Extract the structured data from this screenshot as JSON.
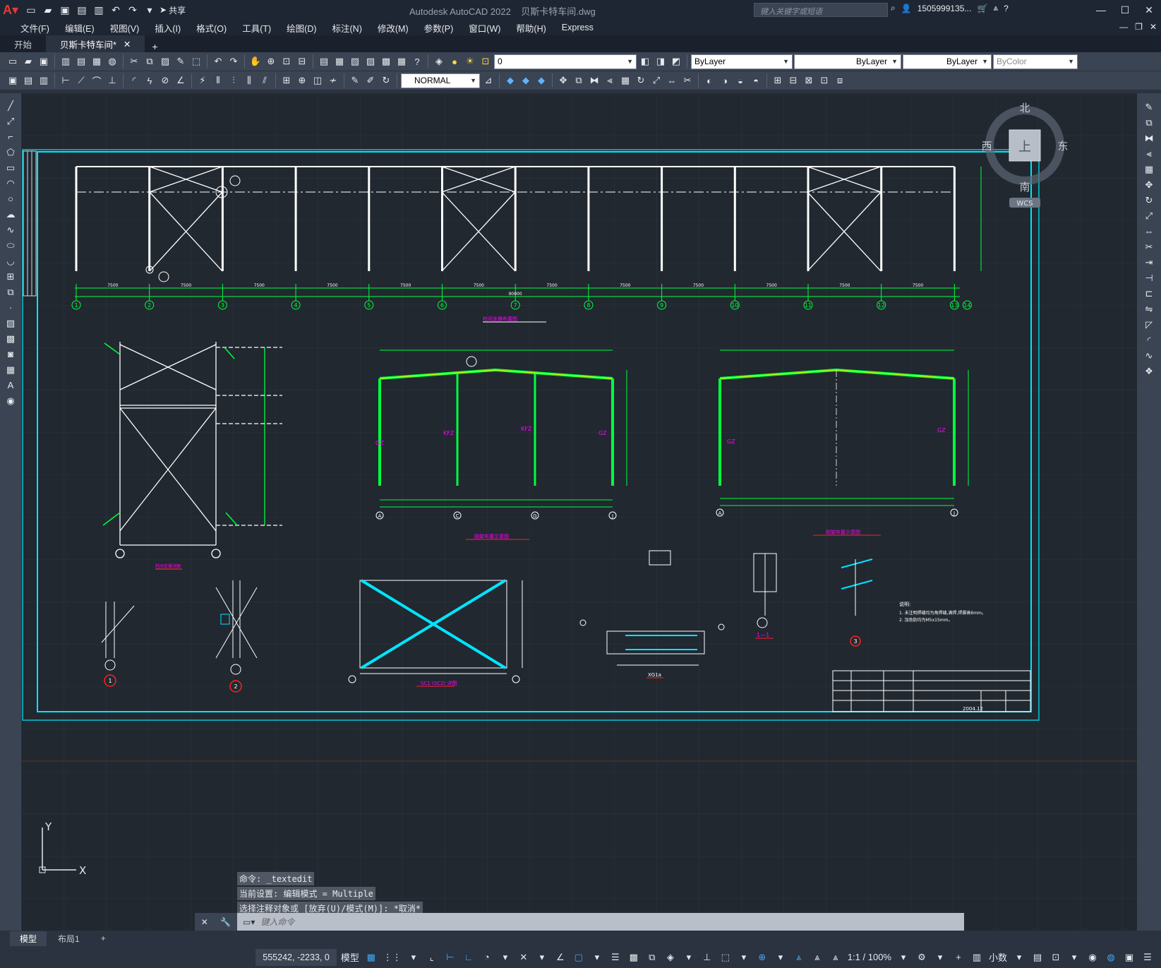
{
  "app": {
    "title": "Autodesk AutoCAD 2022",
    "file": "贝斯卡特车间.dwg",
    "search_placeholder": "键入关键字或短语",
    "user": "1505999135...",
    "share": "共享"
  },
  "menus": [
    "文件(F)",
    "编辑(E)",
    "视图(V)",
    "插入(I)",
    "格式(O)",
    "工具(T)",
    "绘图(D)",
    "标注(N)",
    "修改(M)",
    "参数(P)",
    "窗口(W)",
    "帮助(H)",
    "Express"
  ],
  "tabs": [
    {
      "label": "开始"
    },
    {
      "label": "贝斯卡特车间*"
    }
  ],
  "toolbar": {
    "layer": "0",
    "color": "ByLayer",
    "linetype": "ByLayer",
    "lineweight": "ByLayer",
    "plotstyle": "ByColor",
    "dimstyle": "NORMAL"
  },
  "viewcube": {
    "north": "北",
    "south": "南",
    "east": "东",
    "west": "西",
    "top": "上",
    "wcs": "WCS"
  },
  "drawing": {
    "axis_numbers": [
      "1",
      "2",
      "3",
      "4",
      "5",
      "6",
      "7",
      "8",
      "9",
      "10",
      "11",
      "12",
      "13",
      "14"
    ],
    "bay_dim": "7500",
    "total_dim": "90000",
    "section_left_axes": [
      "A",
      "C",
      "G",
      "J"
    ],
    "section_right_axes": [
      "A",
      "J"
    ],
    "title_1": "柱间支撑布置图",
    "title_2": "刚架布置示意图",
    "title_3": "刚架布置示意图",
    "title_4": "柱间支撑详图",
    "title_5": "SC1 (SC2) 详图",
    "title_6": "XG1a",
    "title_7": "1—1",
    "label_gz": "GZ",
    "label_kfz": "KFZ",
    "detail_nums": [
      "1",
      "2",
      "3"
    ],
    "notes_title": "说明:",
    "note_1": "1. 未注明焊缝均为角焊缝,满焊,焊脚高6mm。",
    "note_2": "2. 加劲肋均为M5x15mm。",
    "date": "2004.12"
  },
  "ucs": {
    "x": "X",
    "y": "Y"
  },
  "command": {
    "history": [
      "命令: _textedit",
      "当前设置: 编辑模式 = Multiple",
      "选择注释对象或 [放弃(U)/模式(M)]: *取消*"
    ],
    "placeholder": "键入命令"
  },
  "layout_tabs": [
    {
      "label": "模型"
    },
    {
      "label": "布局1"
    }
  ],
  "status": {
    "coords": "555242, -2233, 0",
    "model": "模型",
    "scale": "1:1 / 100%",
    "units": "小数"
  },
  "colors": {
    "accent": "#3fa9f5",
    "canvas": "#212830",
    "cyan": "#00e5ff",
    "green": "#00ff3c",
    "yellow": "#ffff00",
    "magenta": "#ff00ff",
    "red": "#ff2020"
  }
}
